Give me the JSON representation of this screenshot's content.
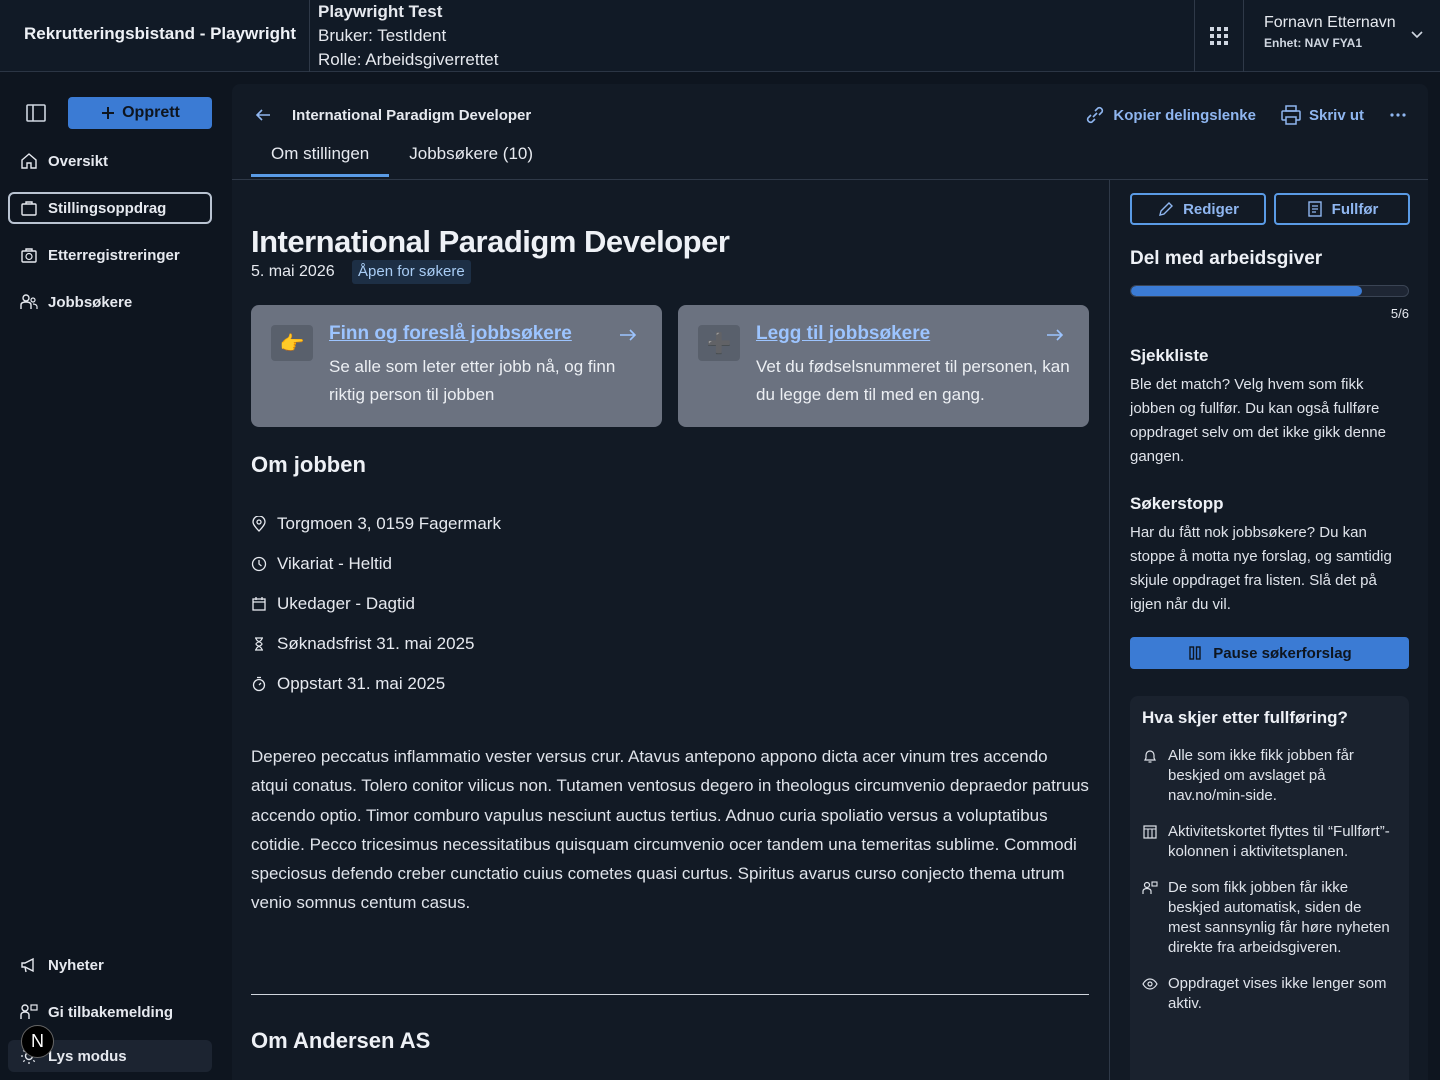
{
  "topbar": {
    "app_title": "Rekrutteringsbistand - Playwright",
    "test_title": "Playwright Test",
    "test_user": "Bruker: TestIdent",
    "test_role": "Rolle: Arbeidsgiverrettet",
    "user_name": "Fornavn Etternavn",
    "user_unit": "Enhet: NAV FYA1"
  },
  "sidebar": {
    "create_label": "Opprett",
    "items": [
      {
        "label": "Oversikt",
        "icon": "home-icon"
      },
      {
        "label": "Stillingsoppdrag",
        "icon": "briefcase-icon"
      },
      {
        "label": "Etterregistreringer",
        "icon": "briefcase-clock-icon"
      },
      {
        "label": "Jobbsøkere",
        "icon": "people-icon"
      }
    ],
    "bottom": [
      {
        "label": "Nyheter",
        "icon": "megaphone-icon"
      },
      {
        "label": "Gi tilbakemelding",
        "icon": "chat-person-icon"
      },
      {
        "label": "Lys modus",
        "icon": "sun-icon"
      }
    ],
    "n_badge": "N"
  },
  "header": {
    "title": "International Paradigm Developer",
    "copy_link": "Kopier delingslenke",
    "print": "Skriv ut"
  },
  "tabs": [
    {
      "label": "Om stillingen"
    },
    {
      "label": "Jobbsøkere (10)"
    }
  ],
  "job": {
    "title": "International Paradigm Developer",
    "date": "5. mai 2026",
    "status": "Åpen for søkere"
  },
  "cards": [
    {
      "icon": "👉",
      "link": "Finn og foreslå jobbsøkere",
      "text": "Se alle som leter etter jobb nå, og finn riktig person til jobben"
    },
    {
      "icon": "➕",
      "link": "Legg til jobbsøkere",
      "text": "Vet du fødselsnummeret til personen, kan du legge dem til med en gang."
    }
  ],
  "about": {
    "heading": "Om jobben",
    "facts": [
      {
        "icon": "location-icon",
        "text": "Torgmoen 3, 0159 Fagermark"
      },
      {
        "icon": "clock-icon",
        "text": "Vikariat - Heltid"
      },
      {
        "icon": "calendar-icon",
        "text": "Ukedager - Dagtid"
      },
      {
        "icon": "hourglass-icon",
        "text": "Søknadsfrist 31. mai 2025"
      },
      {
        "icon": "stopwatch-icon",
        "text": "Oppstart 31. mai 2025"
      }
    ],
    "description": "Depereo peccatus inflammatio vester versus crur. Atavus antepono appono dicta acer vinum tres accendo atqui conatus. Tolero conitor vilicus non. Tutamen ventosus degero in theologus circumvenio depraedor patruus accendo optio. Timor comburo vapulus nesciunt auctus tertius. Adnuo curia spoliatio versus a voluptatibus cotidie. Pecco tricesimus necessitatibus quisquam circumvenio ocer tandem una temeritas sublime. Commodi speciosus defendo creber cunctatio cuius cometes quasi curtus. Spiritus avarus curso conjecto thema utrum venio somnus centum casus.",
    "employer_heading": "Om Andersen AS"
  },
  "right": {
    "edit_label": "Rediger",
    "finish_label": "Fullfør",
    "share_heading": "Del med arbeidsgiver",
    "progress_value": 0.833,
    "progress_label": "5/6",
    "checklist_heading": "Sjekkliste",
    "checklist_text": "Ble det match? Velg hvem som fikk jobben og fullfør. Du kan også fullføre oppdraget selv om det ikke gikk denne gangen.",
    "stop_heading": "Søkerstopp",
    "stop_text": "Har du fått nok jobbsøkere? Du kan stoppe å motta nye forslag, og samtidig skjule oppdraget fra listen. Slå det på igjen når du vil.",
    "pause_label": "Pause søkerforslag",
    "info_title": "Hva skjer etter fullføring?",
    "info_items": [
      {
        "icon": "bell-icon",
        "text": "Alle som ikke fikk jobben får beskjed om avslaget på nav.no/min-side."
      },
      {
        "icon": "board-icon",
        "text": "Aktivitetskortet flyttes til “Fullført”-kolonnen i aktivitetsplanen."
      },
      {
        "icon": "people-chat-icon",
        "text": "De som fikk jobben får ikke beskjed automatisk, siden de mest sannsynlig får høre nyheten direkte fra arbeidsgiveren."
      },
      {
        "icon": "eye-icon",
        "text": "Oppdraget vises ikke lenger som aktiv."
      }
    ]
  }
}
